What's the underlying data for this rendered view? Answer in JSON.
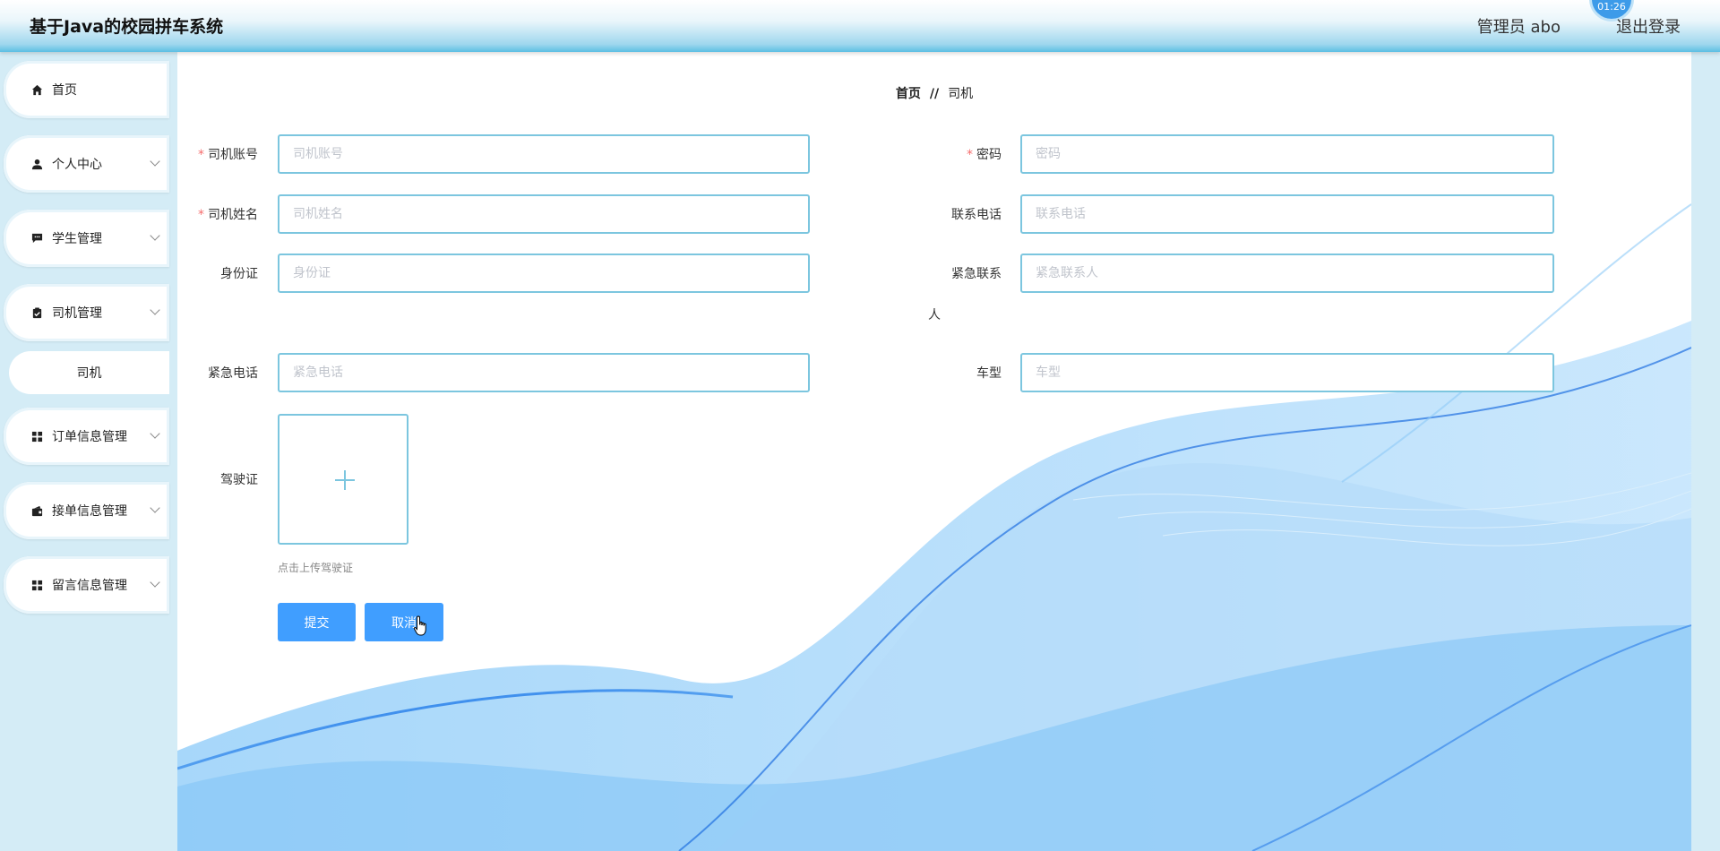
{
  "header": {
    "title": "基于Java的校园拼车系统",
    "user_text": "管理员 abo",
    "logout_label": "退出登录",
    "clock_text": "01:26"
  },
  "sidebar": {
    "items": [
      {
        "label": "首页",
        "icon": "home-icon",
        "has_children": false
      },
      {
        "label": "个人中心",
        "icon": "user-icon",
        "has_children": true
      },
      {
        "label": "学生管理",
        "icon": "chat-icon",
        "has_children": true
      },
      {
        "label": "司机管理",
        "icon": "clipboard-icon",
        "has_children": true,
        "expanded": true,
        "children": [
          "司机"
        ]
      },
      {
        "label": "订单信息管理",
        "icon": "grid-icon",
        "has_children": true
      },
      {
        "label": "接单信息管理",
        "icon": "wallet-icon",
        "has_children": true
      },
      {
        "label": "留言信息管理",
        "icon": "grid-icon",
        "has_children": true
      }
    ]
  },
  "breadcrumb": {
    "home": "首页",
    "separator": "//",
    "current": "司机"
  },
  "form": {
    "driver_account": {
      "label": "司机账号",
      "placeholder": "司机账号",
      "required": true
    },
    "password": {
      "label": "密码",
      "placeholder": "密码",
      "required": true
    },
    "driver_name": {
      "label": "司机姓名",
      "placeholder": "司机姓名",
      "required": true
    },
    "phone": {
      "label": "联系电话",
      "placeholder": "联系电话",
      "required": false
    },
    "id_card": {
      "label": "身份证",
      "placeholder": "身份证",
      "required": false
    },
    "emergency_contact": {
      "label_line1": "紧急联系",
      "label_line2": "人",
      "placeholder": "紧急联系人",
      "required": false
    },
    "emergency_phone": {
      "label": "紧急电话",
      "placeholder": "紧急电话",
      "required": false
    },
    "car_model": {
      "label": "车型",
      "placeholder": "车型",
      "required": false
    },
    "license": {
      "label": "驾驶证",
      "tip": "点击上传驾驶证"
    }
  },
  "buttons": {
    "submit": "提交",
    "cancel": "取消"
  },
  "colors": {
    "accent": "#409eff",
    "input_border": "#7cc6df",
    "required": "#f56c6c",
    "sidebar_bg": "#d4ecf6"
  }
}
